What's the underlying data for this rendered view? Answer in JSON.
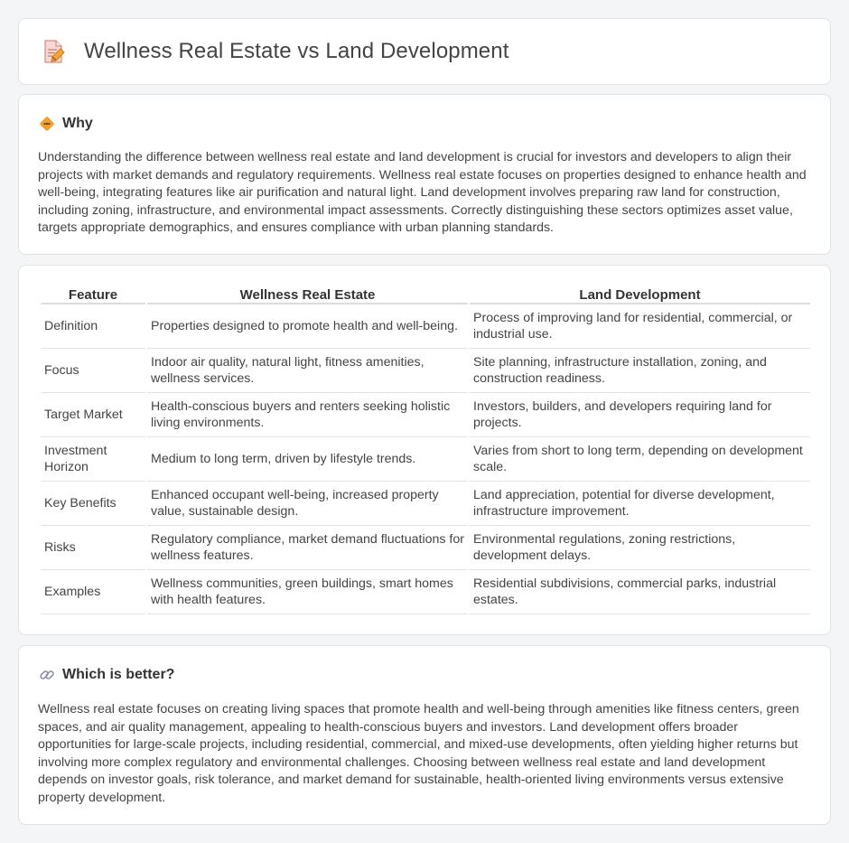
{
  "page": {
    "title": "Wellness Real Estate vs Land Development",
    "title_icon": "document-edit-icon"
  },
  "why": {
    "icon": "diamond-warning-icon",
    "heading": "Why",
    "text": "Understanding the difference between wellness real estate and land development is crucial for investors and developers to align their projects with market demands and regulatory requirements. Wellness real estate focuses on properties designed to enhance health and well-being, integrating features like air purification and natural light. Land development involves preparing raw land for construction, including zoning, infrastructure, and environmental impact assessments. Correctly distinguishing these sectors optimizes asset value, targets appropriate demographics, and ensures compliance with urban planning standards."
  },
  "comparison": {
    "headers": [
      "Feature",
      "Wellness Real Estate",
      "Land Development"
    ],
    "rows": [
      {
        "feature": "Definition",
        "wellness": "Properties designed to promote health and well-being.",
        "land": "Process of improving land for residential, commercial, or industrial use."
      },
      {
        "feature": "Focus",
        "wellness": "Indoor air quality, natural light, fitness amenities, wellness services.",
        "land": "Site planning, infrastructure installation, zoning, and construction readiness."
      },
      {
        "feature": "Target Market",
        "wellness": "Health-conscious buyers and renters seeking holistic living environments.",
        "land": "Investors, builders, and developers requiring land for projects."
      },
      {
        "feature": "Investment Horizon",
        "wellness": "Medium to long term, driven by lifestyle trends.",
        "land": "Varies from short to long term, depending on development scale."
      },
      {
        "feature": "Key Benefits",
        "wellness": "Enhanced occupant well-being, increased property value, sustainable design.",
        "land": "Land appreciation, potential for diverse development, infrastructure improvement."
      },
      {
        "feature": "Risks",
        "wellness": "Regulatory compliance, market demand fluctuations for wellness features.",
        "land": "Environmental regulations, zoning restrictions, development delays."
      },
      {
        "feature": "Examples",
        "wellness": "Wellness communities, green buildings, smart homes with health features.",
        "land": "Residential subdivisions, commercial parks, industrial estates."
      }
    ]
  },
  "better": {
    "icon": "link-icon",
    "heading": "Which is better?",
    "text": "Wellness real estate focuses on creating living spaces that promote health and well-being through amenities like fitness centers, green spaces, and air quality management, appealing to health-conscious buyers and investors. Land development offers broader opportunities for large-scale projects, including residential, commercial, and mixed-use developments, often yielding higher returns but involving more complex regulatory and environmental challenges. Choosing between wellness real estate and land development depends on investor goals, risk tolerance, and market demand for sustainable, health-oriented living environments versus extensive property development."
  },
  "colors": {
    "background": "#f4f5f7",
    "card": "#ffffff",
    "accent_orange": "#f0a030",
    "icon_pink": "#e88a8a"
  }
}
